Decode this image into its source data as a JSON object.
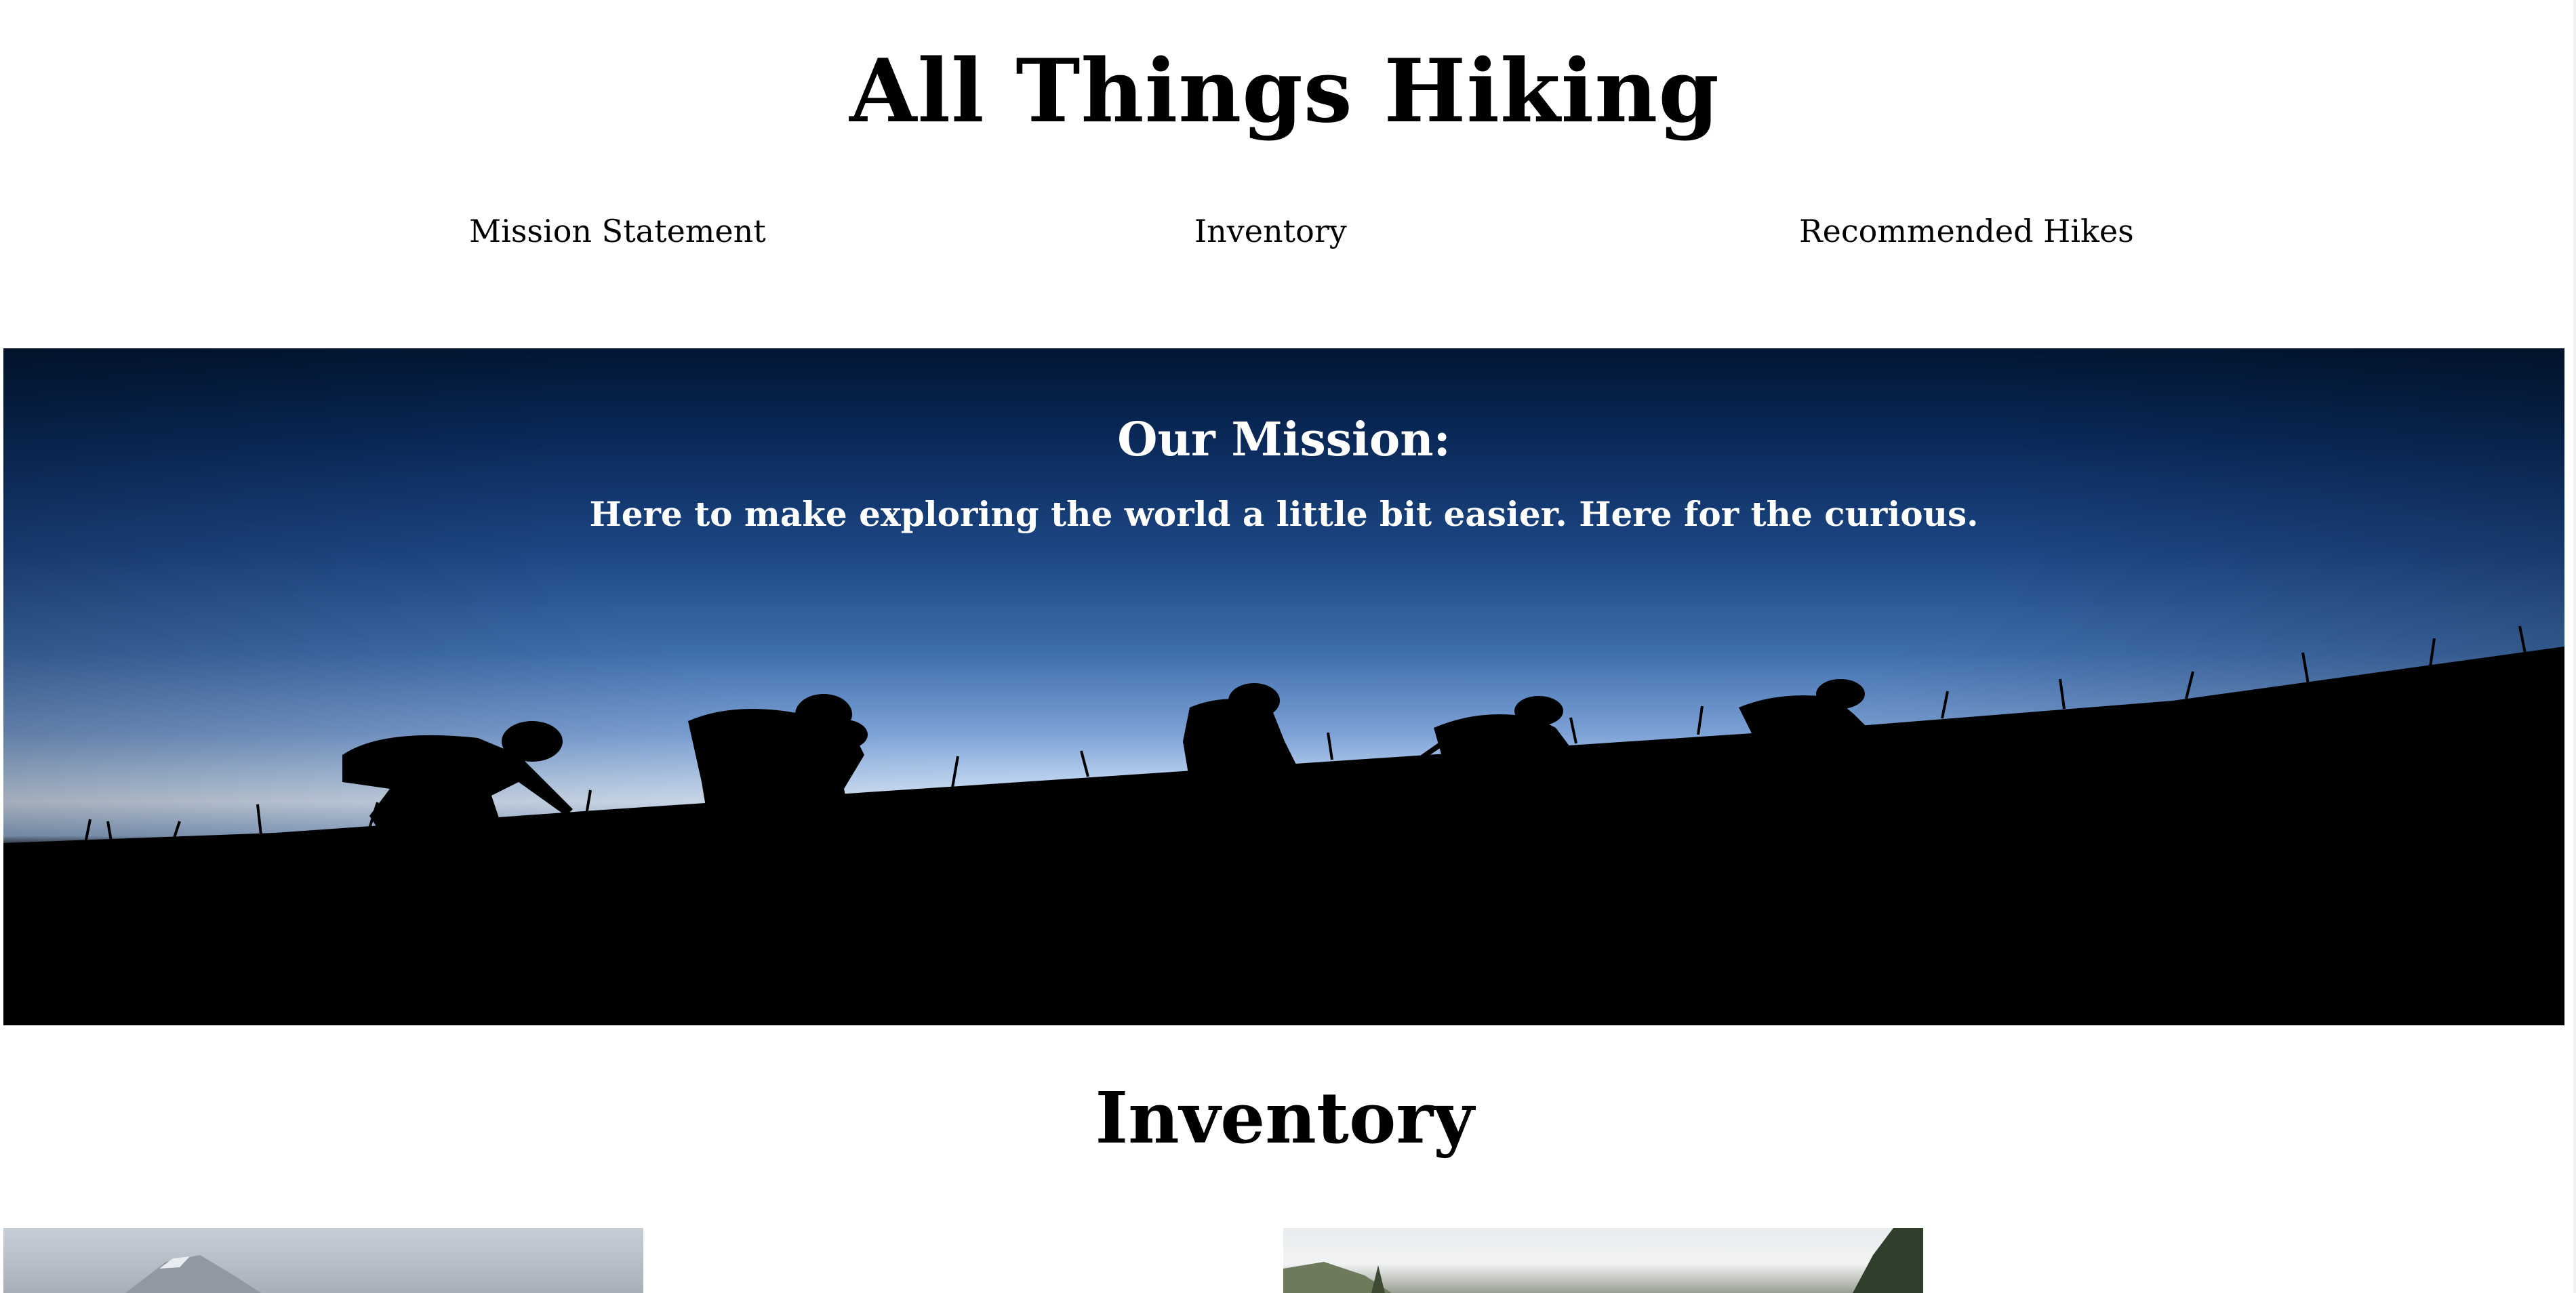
{
  "site": {
    "title": "All Things Hiking"
  },
  "nav": {
    "items": [
      {
        "label": "Mission Statement"
      },
      {
        "label": "Inventory"
      },
      {
        "label": "Recommended Hikes"
      }
    ]
  },
  "hero": {
    "heading": "Our Mission:",
    "text": "Here to make exploring the world a little bit easier. Here for the curious."
  },
  "inventory": {
    "heading": "Inventory"
  },
  "colors": {
    "text": "#000000",
    "background": "#ffffff",
    "hero_text": "#ffffff",
    "sky_top": "#021634",
    "sky_horizon": "#d8e6f7"
  }
}
